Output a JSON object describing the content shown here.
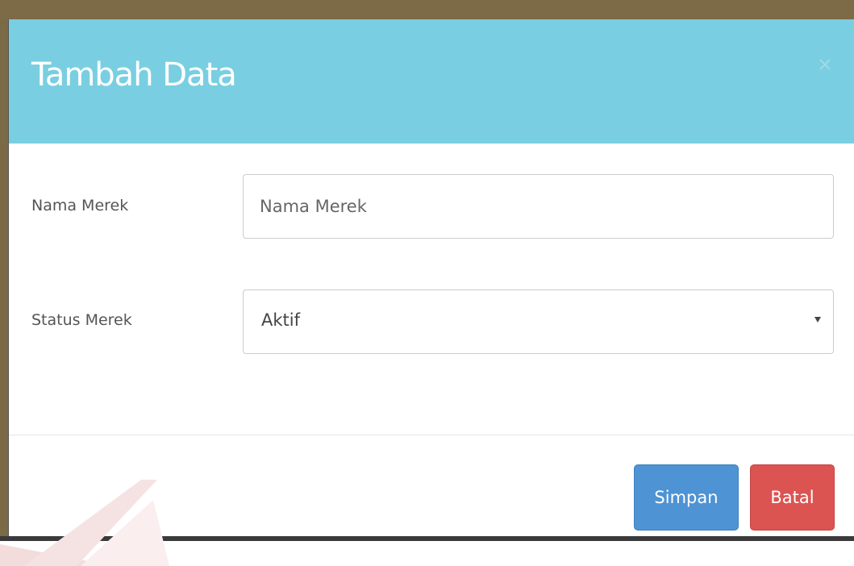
{
  "modal": {
    "title": "Tambah Data",
    "close_icon": "close-icon"
  },
  "form": {
    "brand_name": {
      "label": "Nama Merek",
      "placeholder": "Nama Merek",
      "value": ""
    },
    "brand_status": {
      "label": "Status Merek",
      "selected": "Aktif",
      "caret_icon": "caret-down-icon"
    }
  },
  "footer": {
    "save_label": "Simpan",
    "cancel_label": "Batal"
  },
  "colors": {
    "header": "#79cfe1",
    "save": "#4e93d4",
    "cancel": "#db5452"
  }
}
